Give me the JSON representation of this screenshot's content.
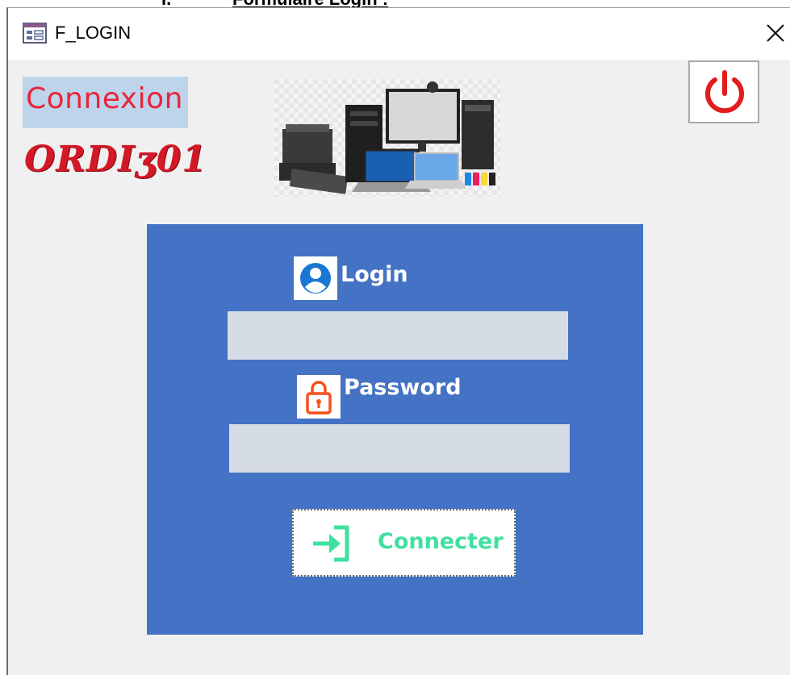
{
  "document": {
    "heading_number": "I.",
    "heading_text": "Formulaire Login :"
  },
  "window": {
    "title": "F_LOGIN",
    "title_icon": "form-icon",
    "close_icon": "close-icon"
  },
  "header": {
    "connexion_label": "Connexion",
    "brand_logo_text": "ORDIʒ01",
    "devices_image": "computer-devices-image",
    "power_icon": "power-icon"
  },
  "login_form": {
    "login_label": "Login",
    "login_icon": "user-icon",
    "login_value": "",
    "password_label": "Password",
    "password_icon": "lock-icon",
    "password_value": "",
    "connect_label": "Connecter",
    "connect_icon": "login-arrow-icon"
  },
  "colors": {
    "panel": "#4472c4",
    "connexion_text": "#e8253a",
    "connexion_bg": "#bed4ea",
    "power": "#e21c1c",
    "connect_text": "#3fe0a0",
    "field_bg": "#d6dce5"
  }
}
